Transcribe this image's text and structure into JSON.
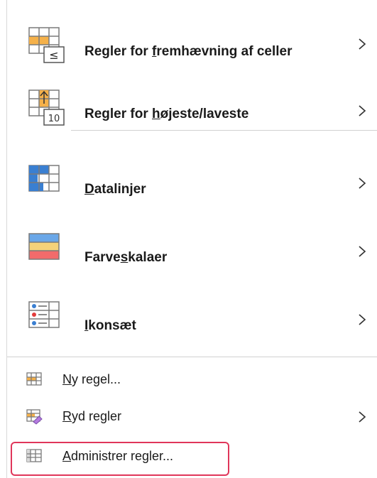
{
  "menu": {
    "items": [
      {
        "pre": "Regler for ",
        "u": "f",
        "post": "remhævning af celler",
        "icon": "highlight-cells-rules-icon",
        "submenu": true
      },
      {
        "pre": "Regler for ",
        "u": "h",
        "post": "øjeste/laveste",
        "icon": "top-bottom-rules-icon",
        "badge": "10",
        "submenu": true
      },
      {
        "pre": "",
        "u": "D",
        "post": "atalinjer",
        "icon": "data-bars-icon",
        "submenu": true
      },
      {
        "pre": "Farve",
        "u": "s",
        "post": "kalaer",
        "icon": "color-scales-icon",
        "submenu": true
      },
      {
        "pre": "",
        "u": "I",
        "post": "konsæt",
        "icon": "icon-sets-icon",
        "submenu": true
      },
      {
        "pre": "",
        "u": "N",
        "post": "y regel...",
        "icon": "new-rule-icon",
        "submenu": false
      },
      {
        "pre": "",
        "u": "R",
        "post": "yd regler",
        "icon": "clear-rules-icon",
        "submenu": true
      },
      {
        "pre": "",
        "u": "A",
        "post": "dministrer regler...",
        "icon": "manage-rules-icon",
        "submenu": false
      }
    ],
    "colors": {
      "highlight_border": "#e0365a",
      "accent_orange": "#f5b14a",
      "accent_blue": "#3a7fd1",
      "accent_red": "#f26b6b"
    }
  }
}
